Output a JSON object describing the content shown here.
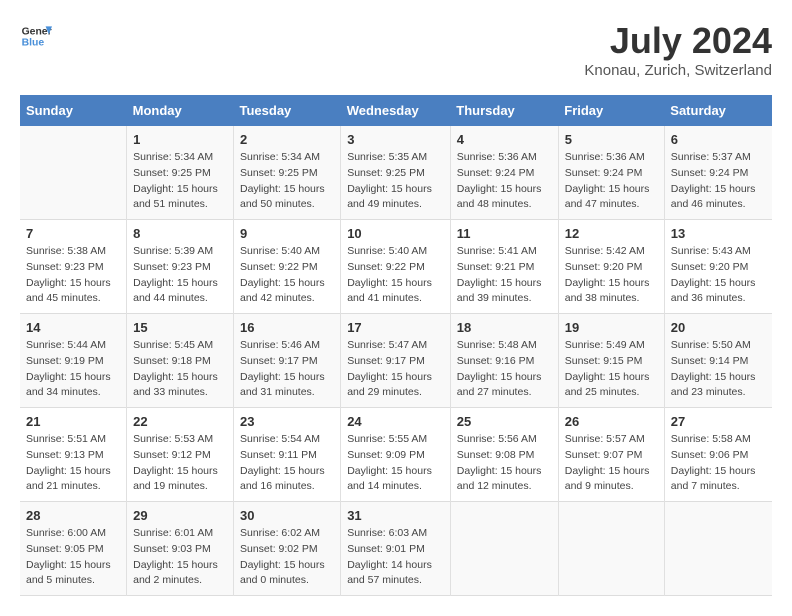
{
  "header": {
    "logo_line1": "General",
    "logo_line2": "Blue",
    "month": "July 2024",
    "location": "Knonau, Zurich, Switzerland"
  },
  "weekdays": [
    "Sunday",
    "Monday",
    "Tuesday",
    "Wednesday",
    "Thursday",
    "Friday",
    "Saturday"
  ],
  "weeks": [
    [
      {
        "day": "",
        "sunrise": "",
        "sunset": "",
        "daylight": ""
      },
      {
        "day": "1",
        "sunrise": "Sunrise: 5:34 AM",
        "sunset": "Sunset: 9:25 PM",
        "daylight": "Daylight: 15 hours and 51 minutes."
      },
      {
        "day": "2",
        "sunrise": "Sunrise: 5:34 AM",
        "sunset": "Sunset: 9:25 PM",
        "daylight": "Daylight: 15 hours and 50 minutes."
      },
      {
        "day": "3",
        "sunrise": "Sunrise: 5:35 AM",
        "sunset": "Sunset: 9:25 PM",
        "daylight": "Daylight: 15 hours and 49 minutes."
      },
      {
        "day": "4",
        "sunrise": "Sunrise: 5:36 AM",
        "sunset": "Sunset: 9:24 PM",
        "daylight": "Daylight: 15 hours and 48 minutes."
      },
      {
        "day": "5",
        "sunrise": "Sunrise: 5:36 AM",
        "sunset": "Sunset: 9:24 PM",
        "daylight": "Daylight: 15 hours and 47 minutes."
      },
      {
        "day": "6",
        "sunrise": "Sunrise: 5:37 AM",
        "sunset": "Sunset: 9:24 PM",
        "daylight": "Daylight: 15 hours and 46 minutes."
      }
    ],
    [
      {
        "day": "7",
        "sunrise": "Sunrise: 5:38 AM",
        "sunset": "Sunset: 9:23 PM",
        "daylight": "Daylight: 15 hours and 45 minutes."
      },
      {
        "day": "8",
        "sunrise": "Sunrise: 5:39 AM",
        "sunset": "Sunset: 9:23 PM",
        "daylight": "Daylight: 15 hours and 44 minutes."
      },
      {
        "day": "9",
        "sunrise": "Sunrise: 5:40 AM",
        "sunset": "Sunset: 9:22 PM",
        "daylight": "Daylight: 15 hours and 42 minutes."
      },
      {
        "day": "10",
        "sunrise": "Sunrise: 5:40 AM",
        "sunset": "Sunset: 9:22 PM",
        "daylight": "Daylight: 15 hours and 41 minutes."
      },
      {
        "day": "11",
        "sunrise": "Sunrise: 5:41 AM",
        "sunset": "Sunset: 9:21 PM",
        "daylight": "Daylight: 15 hours and 39 minutes."
      },
      {
        "day": "12",
        "sunrise": "Sunrise: 5:42 AM",
        "sunset": "Sunset: 9:20 PM",
        "daylight": "Daylight: 15 hours and 38 minutes."
      },
      {
        "day": "13",
        "sunrise": "Sunrise: 5:43 AM",
        "sunset": "Sunset: 9:20 PM",
        "daylight": "Daylight: 15 hours and 36 minutes."
      }
    ],
    [
      {
        "day": "14",
        "sunrise": "Sunrise: 5:44 AM",
        "sunset": "Sunset: 9:19 PM",
        "daylight": "Daylight: 15 hours and 34 minutes."
      },
      {
        "day": "15",
        "sunrise": "Sunrise: 5:45 AM",
        "sunset": "Sunset: 9:18 PM",
        "daylight": "Daylight: 15 hours and 33 minutes."
      },
      {
        "day": "16",
        "sunrise": "Sunrise: 5:46 AM",
        "sunset": "Sunset: 9:17 PM",
        "daylight": "Daylight: 15 hours and 31 minutes."
      },
      {
        "day": "17",
        "sunrise": "Sunrise: 5:47 AM",
        "sunset": "Sunset: 9:17 PM",
        "daylight": "Daylight: 15 hours and 29 minutes."
      },
      {
        "day": "18",
        "sunrise": "Sunrise: 5:48 AM",
        "sunset": "Sunset: 9:16 PM",
        "daylight": "Daylight: 15 hours and 27 minutes."
      },
      {
        "day": "19",
        "sunrise": "Sunrise: 5:49 AM",
        "sunset": "Sunset: 9:15 PM",
        "daylight": "Daylight: 15 hours and 25 minutes."
      },
      {
        "day": "20",
        "sunrise": "Sunrise: 5:50 AM",
        "sunset": "Sunset: 9:14 PM",
        "daylight": "Daylight: 15 hours and 23 minutes."
      }
    ],
    [
      {
        "day": "21",
        "sunrise": "Sunrise: 5:51 AM",
        "sunset": "Sunset: 9:13 PM",
        "daylight": "Daylight: 15 hours and 21 minutes."
      },
      {
        "day": "22",
        "sunrise": "Sunrise: 5:53 AM",
        "sunset": "Sunset: 9:12 PM",
        "daylight": "Daylight: 15 hours and 19 minutes."
      },
      {
        "day": "23",
        "sunrise": "Sunrise: 5:54 AM",
        "sunset": "Sunset: 9:11 PM",
        "daylight": "Daylight: 15 hours and 16 minutes."
      },
      {
        "day": "24",
        "sunrise": "Sunrise: 5:55 AM",
        "sunset": "Sunset: 9:09 PM",
        "daylight": "Daylight: 15 hours and 14 minutes."
      },
      {
        "day": "25",
        "sunrise": "Sunrise: 5:56 AM",
        "sunset": "Sunset: 9:08 PM",
        "daylight": "Daylight: 15 hours and 12 minutes."
      },
      {
        "day": "26",
        "sunrise": "Sunrise: 5:57 AM",
        "sunset": "Sunset: 9:07 PM",
        "daylight": "Daylight: 15 hours and 9 minutes."
      },
      {
        "day": "27",
        "sunrise": "Sunrise: 5:58 AM",
        "sunset": "Sunset: 9:06 PM",
        "daylight": "Daylight: 15 hours and 7 minutes."
      }
    ],
    [
      {
        "day": "28",
        "sunrise": "Sunrise: 6:00 AM",
        "sunset": "Sunset: 9:05 PM",
        "daylight": "Daylight: 15 hours and 5 minutes."
      },
      {
        "day": "29",
        "sunrise": "Sunrise: 6:01 AM",
        "sunset": "Sunset: 9:03 PM",
        "daylight": "Daylight: 15 hours and 2 minutes."
      },
      {
        "day": "30",
        "sunrise": "Sunrise: 6:02 AM",
        "sunset": "Sunset: 9:02 PM",
        "daylight": "Daylight: 15 hours and 0 minutes."
      },
      {
        "day": "31",
        "sunrise": "Sunrise: 6:03 AM",
        "sunset": "Sunset: 9:01 PM",
        "daylight": "Daylight: 14 hours and 57 minutes."
      },
      {
        "day": "",
        "sunrise": "",
        "sunset": "",
        "daylight": ""
      },
      {
        "day": "",
        "sunrise": "",
        "sunset": "",
        "daylight": ""
      },
      {
        "day": "",
        "sunrise": "",
        "sunset": "",
        "daylight": ""
      }
    ]
  ]
}
